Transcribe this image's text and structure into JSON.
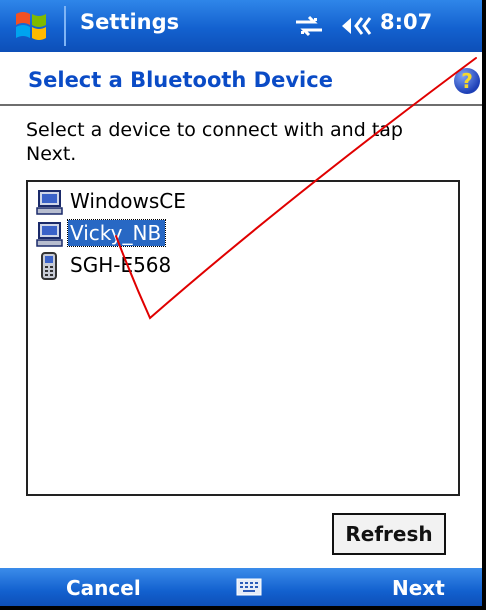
{
  "titlebar": {
    "app_title": "Settings",
    "time": "8:07",
    "start_icon": "windows-logo",
    "connectivity_icon": "connectivity-icon",
    "volume_icon": "speaker-icon"
  },
  "header": {
    "title": "Select a Bluetooth Device",
    "help_label": "?"
  },
  "instruction": "Select a device to connect with and tap Next.",
  "devices": [
    {
      "label": "WindowsCE",
      "icon": "computer-icon",
      "selected": false
    },
    {
      "label": "Vicky_NB",
      "icon": "computer-icon",
      "selected": true
    },
    {
      "label": "SGH-E568",
      "icon": "phone-icon",
      "selected": false
    }
  ],
  "buttons": {
    "refresh": "Refresh"
  },
  "softkeys": {
    "left": "Cancel",
    "right": "Next",
    "center_icon": "keyboard-icon"
  },
  "colors": {
    "titlebar": "#1361cf",
    "header_text": "#0a4bc6",
    "selection": "#2868c4",
    "annotation_stroke": "#e00000"
  }
}
